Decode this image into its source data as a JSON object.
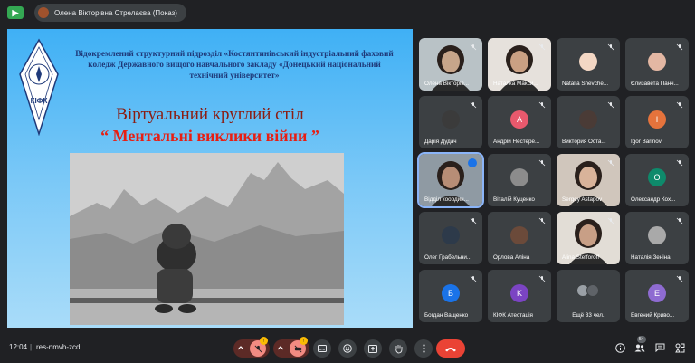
{
  "topbar": {
    "presenter_label": "Олена Вікторівна Стрелаєва (Показ)"
  },
  "slide": {
    "header": "Відокремлений структурний підрозділ «Костянтинівський індустріальний фаховий коледж Державного вищого навчального закладу «Донецький національний  технічний університет»",
    "title": "Віртуальний круглий стіл",
    "subtitle": "“ Ментальні виклики війни ”",
    "emblem_text": "КІФК"
  },
  "participants": [
    {
      "name": "Олена Вікторів...",
      "type": "video",
      "skin": "#c7a58a",
      "bg": "#b9c2c6"
    },
    {
      "name": "Наталка Макси...",
      "type": "video",
      "skin": "#caa083",
      "bg": "#e6e1dc"
    },
    {
      "name": "Natalia Shevche...",
      "type": "avatar",
      "color": "#f3d7c4"
    },
    {
      "name": "Єлизавета Панч...",
      "type": "avatar",
      "color": "#e3b7a3"
    },
    {
      "name": "Дарія Дудач",
      "type": "avatar",
      "color": "#3b3b3b"
    },
    {
      "name": "Андрій Нестере...",
      "type": "letter",
      "letter": "A",
      "color": "#e8596d"
    },
    {
      "name": "Виктория Оста...",
      "type": "avatar",
      "color": "#4a3b36"
    },
    {
      "name": "Igor Barinov",
      "type": "letter",
      "letter": "I",
      "color": "#e5733c"
    },
    {
      "name": "Відділ координ...",
      "type": "video",
      "skin": "#b78d76",
      "bg": "#8f9aa3",
      "active": true
    },
    {
      "name": "Віталій Куценко",
      "type": "avatar",
      "color": "#8c8c8c"
    },
    {
      "name": "Sergey Astapov",
      "type": "video",
      "skin": "#d9b39a",
      "bg": "#d0c6bc"
    },
    {
      "name": "Олександр Кох...",
      "type": "letter",
      "letter": "O",
      "color": "#0e8a6b"
    },
    {
      "name": "Олег Грабельни...",
      "type": "avatar",
      "color": "#2d3a4a"
    },
    {
      "name": "Орлова Аліна",
      "type": "avatar",
      "color": "#6b4a3a"
    },
    {
      "name": "Alina Stefforoff",
      "type": "video",
      "skin": "#c89f86",
      "bg": "#e2ddd6"
    },
    {
      "name": "Наталія Зеніна",
      "type": "avatar",
      "color": "#a9a9a9"
    },
    {
      "name": "Богдан Ващенко",
      "type": "letter",
      "letter": "Б",
      "color": "#1a73e8"
    },
    {
      "name": "КІФК Атестація",
      "type": "letter",
      "letter": "K",
      "color": "#7b44c3"
    },
    {
      "name": "Ещё 33 чел.",
      "type": "more"
    },
    {
      "name": "Евгений Криво...",
      "type": "letter",
      "letter": "E",
      "color": "#8e6bd1"
    }
  ],
  "bottombar": {
    "time": "12:04",
    "separator": "|",
    "meeting_code": "res-nmvh-zcd",
    "participants_count": "54",
    "mic_badge": "!",
    "cam_badge": "!"
  },
  "colors": {
    "accent": "#8ab4f8",
    "end_call": "#ea4335",
    "background": "#202124"
  }
}
